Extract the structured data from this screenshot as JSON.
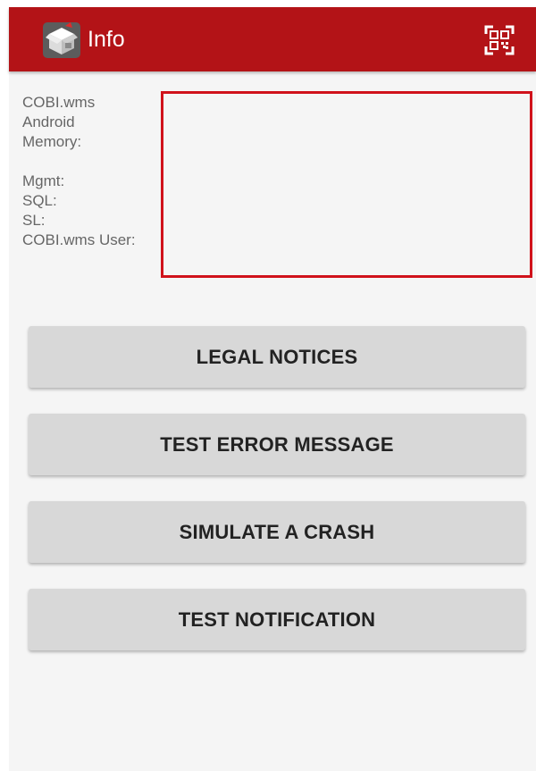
{
  "app_bar": {
    "title": "Info",
    "app_icon": "box-logo-icon",
    "action_icon": "qr-code-icon",
    "background_color": "#b31317"
  },
  "info": {
    "labels": {
      "product": "COBI.wms",
      "android": "Android",
      "memory": "Memory:",
      "mgmt": "Mgmt:",
      "sql": "SQL:",
      "sl": "SL:",
      "user": "COBI.wms User:"
    },
    "highlight_color": "#d0121b"
  },
  "buttons": {
    "legal_notices": "LEGAL NOTICES",
    "test_error_message": "TEST ERROR MESSAGE",
    "simulate_crash": "SIMULATE A CRASH",
    "test_notification": "TEST NOTIFICATION"
  }
}
